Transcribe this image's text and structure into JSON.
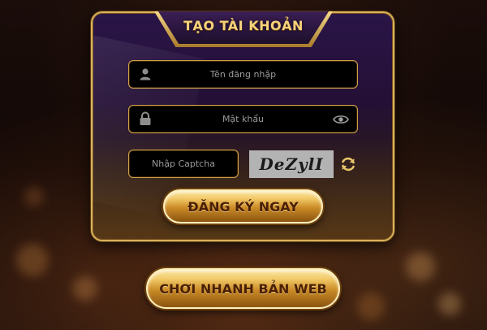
{
  "form": {
    "title": "TẠO TÀI KHOẢN",
    "username": {
      "placeholder": "Tên đăng nhập",
      "icon": "user-icon"
    },
    "password": {
      "placeholder": "Mật khẩu",
      "icon": "lock-icon",
      "toggle_icon": "eye-icon"
    },
    "captcha": {
      "placeholder": "Nhập Captcha",
      "image_text": "DeZylI",
      "refresh_icon": "refresh-icon"
    },
    "register_button": "ĐĂNG KÝ NGAY"
  },
  "play_web_button": "CHƠI NHANH BẢN WEB",
  "colors": {
    "gold": "#d8b25c",
    "title_gold": "#f6d27a",
    "panel_purple": "#2a1548",
    "field_bg": "#000000",
    "button_text": "#4a1f05"
  }
}
